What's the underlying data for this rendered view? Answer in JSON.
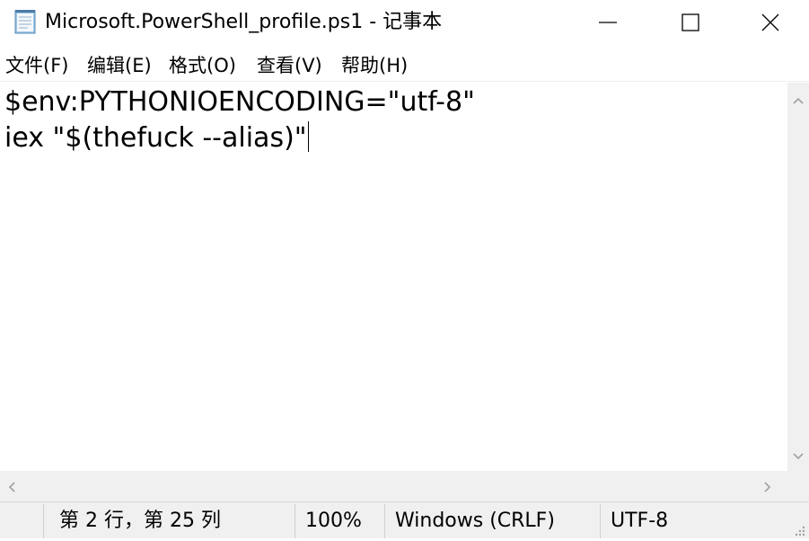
{
  "window": {
    "title": "Microsoft.PowerShell_profile.ps1 - 记事本",
    "icon": "notepad-icon",
    "controls": [
      "minimize-icon",
      "maximize-icon",
      "close-icon"
    ]
  },
  "menu": {
    "items": [
      {
        "label": "文件(F)"
      },
      {
        "label": "编辑(E)"
      },
      {
        "label": "格式(O)"
      },
      {
        "label": "查看(V)"
      },
      {
        "label": "帮助(H)"
      }
    ]
  },
  "editor": {
    "lines": [
      "$env:PYTHONIOENCODING=\"utf-8\"",
      "iex \"$(thefuck --alias)\""
    ]
  },
  "status": {
    "position": "第 2 行，第 25 列",
    "zoom": "100%",
    "line_ending": "Windows (CRLF)",
    "encoding": "UTF-8"
  },
  "colors": {
    "chrome": "#f0f0f0",
    "background": "#ffffff",
    "text": "#000000"
  }
}
